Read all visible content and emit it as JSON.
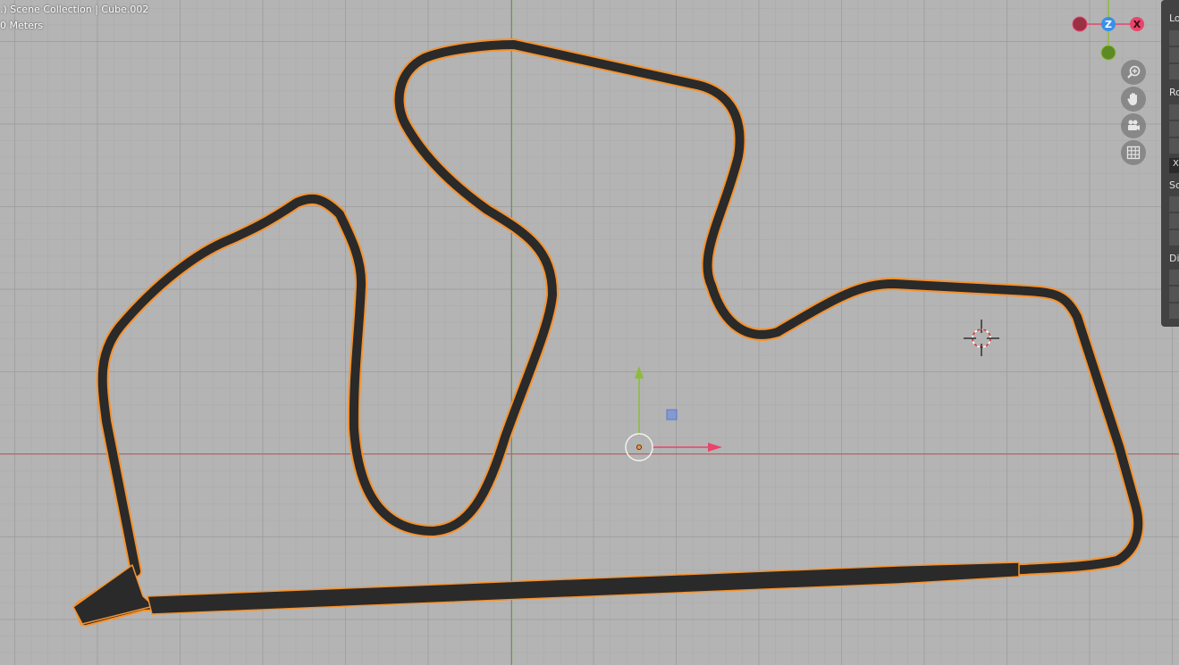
{
  "header": {
    "title": ".) Scene Collection | Cube.002",
    "units": "0 Meters"
  },
  "gizmo": {
    "z_label": "Z",
    "x_label": "X",
    "colors": {
      "x": "#e8456b",
      "y": "#8cbd3a",
      "z": "#3a8fe8"
    }
  },
  "nav_buttons": [
    {
      "icon": "zoom-icon"
    },
    {
      "icon": "hand-pan-icon"
    },
    {
      "icon": "camera-icon"
    },
    {
      "icon": "grid-icon"
    }
  ],
  "n_panel": {
    "sections": [
      {
        "label": "Lo"
      },
      {
        "label": "Ro"
      },
      {
        "label": "Sc"
      },
      {
        "label": "Di"
      }
    ],
    "rotation_mode_field": "X"
  },
  "colors": {
    "viewport_bg": "#b4b4b4",
    "track_fill": "#2a2a2a",
    "selection_outline": "#f6922c",
    "x_axis": "#c25a5a",
    "y_axis": "#6f9a3c"
  }
}
